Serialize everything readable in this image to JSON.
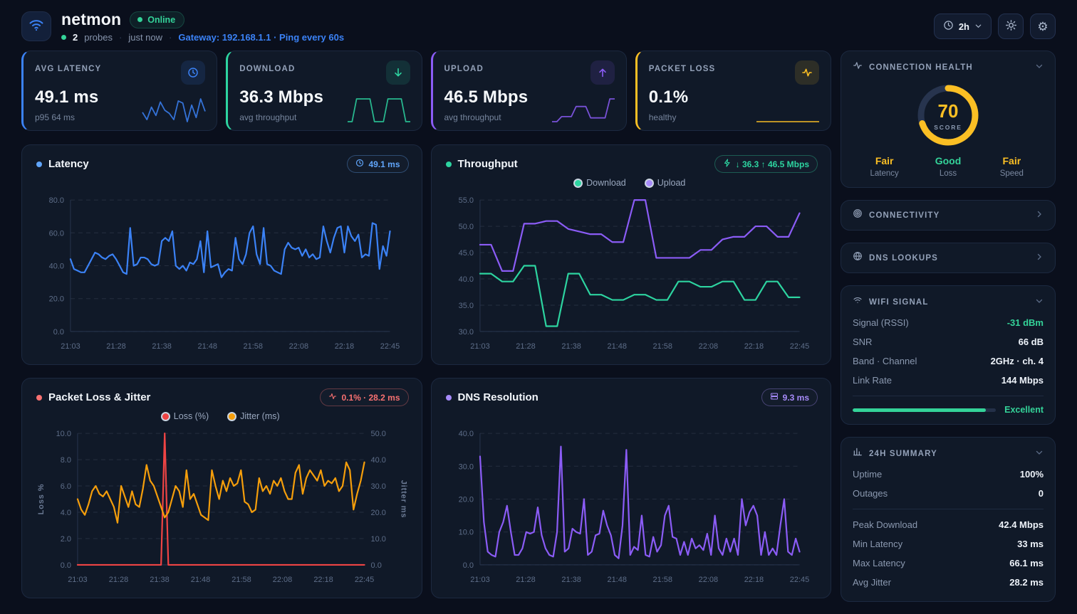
{
  "header": {
    "app_name": "netmon",
    "status_badge": "Online",
    "probes_count": "2",
    "probes_label": "probes",
    "updated": "just now",
    "gateway_info": "Gateway: 192.168.1.1 · Ping every 60s",
    "time_range": "2h"
  },
  "stat_cards": [
    {
      "label": "AVG LATENCY",
      "value": "49.1 ms",
      "sub": "p95 64 ms",
      "accent": "#3b82f6",
      "accent_bg": "rgba(59,130,246,0.13)",
      "icon": "clock-icon",
      "spark": [
        45,
        38,
        50,
        42,
        55,
        47,
        44,
        38,
        56,
        54,
        36,
        52,
        40,
        58,
        46
      ]
    },
    {
      "label": "DOWNLOAD",
      "value": "36.3 Mbps",
      "sub": "avg throughput",
      "accent": "#2dd4a0",
      "accent_bg": "rgba(45,212,160,0.13)",
      "icon": "arrow-down-icon",
      "spark": [
        32,
        32,
        42,
        42,
        42,
        42,
        32,
        32,
        32,
        42,
        42,
        42,
        42,
        32,
        32
      ]
    },
    {
      "label": "UPLOAD",
      "value": "46.5 Mbps",
      "sub": "avg throughput",
      "accent": "#8b5cf6",
      "accent_bg": "rgba(139,92,246,0.13)",
      "icon": "arrow-up-icon",
      "spark": [
        30,
        30,
        34,
        34,
        34,
        42,
        42,
        42,
        33,
        33,
        33,
        33,
        48,
        48
      ]
    },
    {
      "label": "PACKET LOSS",
      "value": "0.1%",
      "sub": "healthy",
      "accent": "#fbbf24",
      "accent_bg": "rgba(251,191,36,0.13)",
      "icon": "activity-icon",
      "spark": [
        1,
        1,
        1,
        1,
        1,
        1
      ]
    }
  ],
  "charts": {
    "latency": {
      "title": "Latency",
      "dot_color": "#60a5fa",
      "badge_text": "49.1 ms",
      "badge_color": "#60a5fa",
      "badge_border": "rgba(96,165,250,0.35)"
    },
    "throughput": {
      "title": "Throughput",
      "dot_color": "#2dd4a0",
      "badge_text": "↓ 36.3 ↑ 46.5 Mbps",
      "badge_color": "#2dd4a0",
      "badge_border": "rgba(45,212,160,0.35)",
      "legend": [
        {
          "label": "Download",
          "color": "#2dd4a0"
        },
        {
          "label": "Upload",
          "color": "#a78bfa"
        }
      ]
    },
    "packet": {
      "title": "Packet Loss & Jitter",
      "dot_color": "#f87171",
      "badge_text": "0.1% · 28.2 ms",
      "badge_color": "#f87171",
      "badge_border": "rgba(248,113,113,0.35)",
      "legend": [
        {
          "label": "Loss (%)",
          "color": "#ef4444"
        },
        {
          "label": "Jitter (ms)",
          "color": "#f59e0b"
        }
      ]
    },
    "dns": {
      "title": "DNS Resolution",
      "dot_color": "#a78bfa",
      "badge_text": "9.3 ms",
      "badge_color": "#a78bfa",
      "badge_border": "rgba(167,139,250,0.35)"
    }
  },
  "chart_data": [
    {
      "id": "latency-chart",
      "type": "line",
      "ylim": [
        0,
        80
      ],
      "yticks": [
        80,
        60,
        40,
        20,
        0
      ],
      "xlabels": [
        "21:03",
        "21:28",
        "21:38",
        "21:48",
        "21:58",
        "22:08",
        "22:18",
        "22:45"
      ],
      "series": [
        {
          "name": "Latency (ms)",
          "color": "#3b82f6",
          "values": [
            44,
            38,
            37,
            36,
            36,
            40,
            44,
            48,
            47,
            45,
            44,
            46,
            47,
            44,
            40,
            36,
            35,
            63,
            40,
            41,
            45,
            45,
            44,
            41,
            40,
            41,
            55,
            57,
            55,
            61,
            40,
            38,
            40,
            37,
            42,
            41,
            44,
            55,
            36,
            61,
            39,
            40,
            41,
            33,
            36,
            38,
            37,
            57,
            44,
            41,
            47,
            60,
            64,
            47,
            41,
            63,
            41,
            40,
            37,
            36,
            35,
            50,
            54,
            51,
            50,
            51,
            46,
            50,
            45,
            47,
            44,
            45,
            64,
            55,
            48,
            57,
            63,
            64,
            48,
            64,
            58,
            55,
            59,
            45,
            47,
            46,
            66,
            65,
            38,
            52,
            46,
            61
          ]
        }
      ]
    },
    {
      "id": "throughput-chart",
      "type": "line",
      "ylim": [
        30,
        55
      ],
      "yticks": [
        55,
        50,
        45,
        40,
        35,
        30
      ],
      "xlabels": [
        "21:03",
        "21:28",
        "21:38",
        "21:48",
        "21:58",
        "22:08",
        "22:18",
        "22:45"
      ],
      "series": [
        {
          "name": "Download",
          "color": "#2dd4a0",
          "values": [
            41,
            41,
            39.5,
            39.5,
            42.5,
            42.5,
            31,
            31,
            41,
            41,
            37,
            37,
            36,
            36,
            37,
            37,
            36,
            36,
            39.5,
            39.5,
            38.5,
            38.5,
            39.5,
            39.5,
            36,
            36,
            39.5,
            39.5,
            36.5,
            36.5
          ]
        },
        {
          "name": "Upload",
          "color": "#8b5cf6",
          "values": [
            46.5,
            46.5,
            41.5,
            41.5,
            50.5,
            50.5,
            51,
            51,
            49.5,
            49,
            48.5,
            48.5,
            47,
            47,
            55,
            55,
            44,
            44,
            44,
            44,
            45.5,
            45.5,
            47.5,
            48,
            48,
            50,
            50,
            48,
            48,
            52.5
          ]
        }
      ]
    },
    {
      "id": "packet-chart",
      "type": "line",
      "ylim": [
        0,
        10
      ],
      "yticks": [
        10,
        8,
        6,
        4,
        2,
        0
      ],
      "y2lim": [
        0,
        50
      ],
      "y2ticks": [
        50,
        40,
        30,
        20,
        10,
        0
      ],
      "ylabel": "Loss %",
      "y2label": "Jitter ms",
      "xlabels": [
        "21:03",
        "21:28",
        "21:38",
        "21:48",
        "21:58",
        "22:08",
        "22:18",
        "22:45"
      ],
      "series": [
        {
          "name": "Loss (%)",
          "color": "#ef4444",
          "axis": "left",
          "values": [
            0,
            0,
            0,
            0,
            0,
            0,
            0,
            0,
            0,
            0,
            0,
            0,
            0,
            0,
            0,
            0,
            0,
            0,
            0,
            0,
            0,
            0,
            0,
            0,
            10,
            0,
            0,
            0,
            0,
            0,
            0,
            0,
            0,
            0,
            0,
            0,
            0,
            0,
            0,
            0,
            0,
            0,
            0,
            0,
            0,
            0,
            0,
            0,
            0,
            0,
            0,
            0,
            0,
            0,
            0,
            0,
            0,
            0,
            0,
            0,
            0,
            0,
            0,
            0,
            0,
            0,
            0,
            0,
            0,
            0,
            0,
            0,
            0,
            0,
            0,
            0,
            0,
            0,
            0,
            0
          ]
        },
        {
          "name": "Jitter (ms)",
          "color": "#f59e0b",
          "axis": "right",
          "values": [
            25,
            21,
            19,
            23,
            28,
            30,
            27,
            26,
            28,
            25,
            22,
            16,
            30,
            26,
            22,
            28,
            23,
            22,
            29,
            38,
            32,
            30,
            26,
            22,
            18,
            20,
            25,
            30,
            28,
            22,
            36,
            25,
            27,
            23,
            19,
            18,
            17,
            36,
            30,
            25,
            32,
            28,
            33,
            30,
            31,
            36,
            24,
            23,
            20,
            21,
            33,
            28,
            30,
            27,
            32,
            30,
            33,
            28,
            25,
            25,
            35,
            38,
            27,
            33,
            36,
            34,
            32,
            36,
            30,
            32,
            31,
            33,
            28,
            30,
            39,
            36,
            21,
            27,
            32,
            39
          ]
        }
      ]
    },
    {
      "id": "dns-chart",
      "type": "line",
      "ylim": [
        0,
        40
      ],
      "yticks": [
        40,
        30,
        20,
        10,
        0
      ],
      "xlabels": [
        "21:03",
        "21:28",
        "21:38",
        "21:48",
        "21:58",
        "22:08",
        "22:18",
        "22:45"
      ],
      "series": [
        {
          "name": "DNS (ms)",
          "color": "#8b5cf6",
          "values": [
            33,
            13,
            4,
            3,
            2.5,
            10,
            13,
            18,
            10,
            3,
            3,
            5,
            10,
            9.5,
            10,
            17.5,
            9,
            5,
            3,
            2.5,
            10,
            36,
            4,
            5,
            11,
            10,
            9.5,
            20,
            3,
            4,
            9,
            9.5,
            16.5,
            12,
            9,
            3,
            2,
            12,
            35,
            3,
            5.5,
            4.5,
            15,
            3,
            2.5,
            8.5,
            4,
            6,
            15,
            18,
            8.5,
            8,
            3,
            7,
            3,
            8,
            5,
            6,
            4.5,
            9.5,
            3,
            15,
            5,
            3,
            8,
            4,
            8,
            3,
            20,
            12,
            16,
            18,
            15,
            3,
            10,
            3,
            5,
            3,
            12,
            20,
            4,
            3,
            8,
            4
          ]
        }
      ]
    }
  ],
  "sidebar": {
    "connection_health": {
      "title": "CONNECTION HEALTH",
      "score": "70",
      "score_label": "SCORE",
      "score_color": "#fbbf24",
      "metrics": [
        {
          "value": "Fair",
          "label": "Latency",
          "color": "#fbbf24"
        },
        {
          "value": "Good",
          "label": "Loss",
          "color": "#34d399"
        },
        {
          "value": "Fair",
          "label": "Speed",
          "color": "#fbbf24"
        }
      ]
    },
    "connectivity": {
      "title": "CONNECTIVITY"
    },
    "dns_lookups": {
      "title": "DNS LOOKUPS"
    },
    "wifi": {
      "title": "WIFI SIGNAL",
      "rows": [
        {
          "label": "Signal (RSSI)",
          "value": "-31 dBm"
        },
        {
          "label": "SNR",
          "value": "66 dB"
        },
        {
          "label": "Band · Channel",
          "value": "2GHz · ch. 4"
        },
        {
          "label": "Link Rate",
          "value": "144 Mbps"
        }
      ],
      "quality_label": "Excellent",
      "quality_pct": 93
    },
    "summary": {
      "title": "24H SUMMARY",
      "rows_top": [
        {
          "label": "Uptime",
          "value": "100%"
        },
        {
          "label": "Outages",
          "value": "0"
        }
      ],
      "rows_bottom": [
        {
          "label": "Peak Download",
          "value": "42.4 Mbps"
        },
        {
          "label": "Min Latency",
          "value": "33 ms"
        },
        {
          "label": "Max Latency",
          "value": "66.1 ms"
        },
        {
          "label": "Avg Jitter",
          "value": "28.2 ms"
        }
      ]
    }
  }
}
